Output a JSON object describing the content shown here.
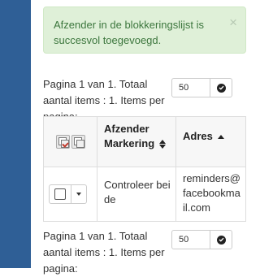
{
  "alert": {
    "message": "Afzender in de blokkeringslijst is succesvol toegevoegd.",
    "close_symbol": "×"
  },
  "pager_top": {
    "text": "Pagina 1 van 1. Totaal aantal items : 1. Items per pagina:",
    "per_page": "50"
  },
  "table": {
    "headers": {
      "col2": "Afzender Markering",
      "col3": "Adres"
    },
    "rows": [
      {
        "markering": "Controleer bei de",
        "adres": "reminders@facebookmail.com"
      }
    ]
  },
  "pager_bottom": {
    "text": "Pagina 1 van 1. Totaal aantal items : 1. Items per pagina:",
    "per_page": "50"
  },
  "colors": {
    "sidebar": "#2f5f96",
    "alert_bg": "#dff0d8",
    "alert_text": "#3c763d"
  },
  "icons": [
    "select-all-icon",
    "select-none-icon",
    "check-circle-icon",
    "sort-both-icon",
    "sort-up-icon",
    "caret-down-icon"
  ]
}
